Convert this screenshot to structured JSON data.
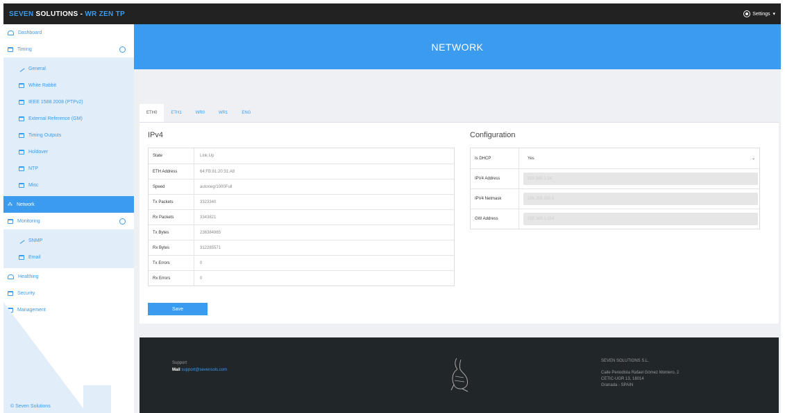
{
  "topbar": {
    "brand_part1": "SEVEN ",
    "brand_part2": "SOLUTIONS - ",
    "brand_part3": "WR ZEN TP",
    "settings_label": "Settings",
    "settings_icon": "gear-icon"
  },
  "sidebar": {
    "items": [
      {
        "label": "Dashboard",
        "icon": "monitor-icon"
      },
      {
        "label": "Timing",
        "icon": "calendar-icon"
      }
    ],
    "timing_sub": [
      {
        "label": "General",
        "icon": "leaf-icon"
      },
      {
        "label": "White Rabbit",
        "icon": "calendar-icon"
      },
      {
        "label": "IEEE 1588 2008 (PTPv2)",
        "icon": "calendar-icon"
      },
      {
        "label": "External Reference (GM)",
        "icon": "calendar-icon"
      },
      {
        "label": "Timing Outputs",
        "icon": "calendar-icon"
      },
      {
        "label": "Holdover",
        "icon": "calendar-icon"
      },
      {
        "label": "NTP",
        "icon": "calendar-icon"
      },
      {
        "label": "Misc",
        "icon": "calendar-icon"
      }
    ],
    "network": {
      "label": "Network",
      "icon": "network-icon"
    },
    "monitoring": {
      "label": "Monitoring",
      "icon": "calendar-icon"
    },
    "monitoring_sub": [
      {
        "label": "SNMP",
        "icon": "leaf-icon"
      },
      {
        "label": "Email",
        "icon": "calendar-icon"
      }
    ],
    "bottom_items": [
      {
        "label": "Healthing",
        "icon": "heart-icon"
      },
      {
        "label": "Security",
        "icon": "lock-icon"
      },
      {
        "label": "Management",
        "icon": "calendar-icon"
      }
    ],
    "copyright": "© Seven Solutions"
  },
  "header": {
    "title": "NETWORK"
  },
  "tabs": [
    "ETH0",
    "ETH1",
    "WR0",
    "WR1",
    "ENG"
  ],
  "ipv4": {
    "title": "IPv4",
    "rows": [
      {
        "key": "State",
        "value": "Link Up"
      },
      {
        "key": "ETH Address",
        "value": "64:FB:81:20:31:A8"
      },
      {
        "key": "Speed",
        "value": "autoneg/1000Full"
      },
      {
        "key": "Tx Packets",
        "value": "3323340"
      },
      {
        "key": "Rx Packets",
        "value": "3343821"
      },
      {
        "key": "Tx Bytes",
        "value": "236384965"
      },
      {
        "key": "Rx Bytes",
        "value": "312285571"
      },
      {
        "key": "Tx Errors",
        "value": "0"
      },
      {
        "key": "Rx Errors",
        "value": "0"
      }
    ]
  },
  "configuration": {
    "title": "Configuration",
    "dhcp_label": "Is DHCP",
    "dhcp_value": "Yes",
    "fields": [
      {
        "key": "IPV4 Address",
        "value": "192.168.1.14"
      },
      {
        "key": "IPV4 Netmask",
        "value": "255.255.255.0"
      },
      {
        "key": "GW Address",
        "value": "192.168.1.254"
      }
    ]
  },
  "save_label": "Save",
  "footer": {
    "support_title": "Support",
    "mail_label": "Mail",
    "mail_value": "support@sevensols.com",
    "company_title": "SEVEN SOLUTIONS S.L.",
    "address_line1": "Calle Periodista Rafael Gómez Montero, 2",
    "address_line2": "CETIC-UGR 13, 18014",
    "address_line3": "Granada - SPAIN"
  }
}
